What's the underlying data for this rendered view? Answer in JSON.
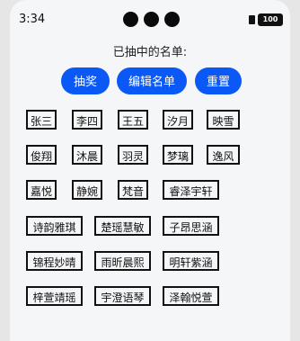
{
  "status_bar": {
    "time": "3:34",
    "battery": "100"
  },
  "header": {
    "title": "已抽中的名单:"
  },
  "actions": {
    "draw_label": "抽奖",
    "edit_label": "编辑名单",
    "reset_label": "重置"
  },
  "colors": {
    "accent": "#0a59f7",
    "background": "#f5f6f8",
    "tag_border": "#111111"
  },
  "names": [
    "张三",
    "李四",
    "王五",
    "汐月",
    "映雪",
    "俊翔",
    "沐晨",
    "羽灵",
    "梦璃",
    "逸风",
    "嘉悦",
    "静婉",
    "梵音",
    "睿泽宇轩",
    "诗韵雅琪",
    "楚瑶慧敏",
    "子昂思涵",
    "锦程妙晴",
    "雨昕晨熙",
    "明轩紫涵",
    "梓萱靖瑶",
    "宇澄语琴",
    "泽翰悦萱"
  ]
}
